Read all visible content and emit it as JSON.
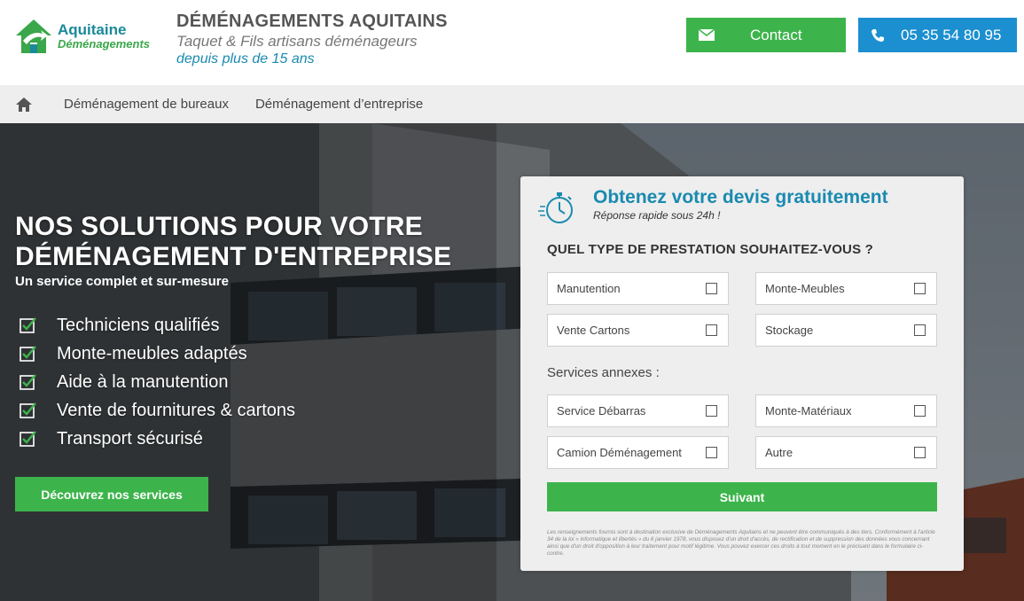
{
  "header": {
    "logo_line1": "Aquitaine",
    "logo_line2": "Déménagements",
    "tagline_title": "DÉMÉNAGEMENTS AQUITAINS",
    "tagline_sub": "Taquet & Fils artisans déménageurs",
    "tagline_since": "depuis plus de 15 ans",
    "contact_label": "Contact",
    "phone_label": "05 35 54 80 95"
  },
  "nav": {
    "items": [
      "Déménagement de bureaux",
      "Déménagement d’entreprise"
    ]
  },
  "hero": {
    "title_line1": "NOS SOLUTIONS POUR VOTRE",
    "title_line2": "DÉMÉNAGEMENT D'ENTREPRISE",
    "subtitle": "Un service complet et sur-mesure",
    "features": [
      "Techniciens qualifiés",
      "Monte-meubles adaptés",
      "Aide à la manutention",
      "Vente de fournitures & cartons",
      "Transport sécurisé"
    ],
    "cta_label": "Découvrez nos services"
  },
  "form": {
    "title": "Obtenez votre devis gratuitement",
    "subtitle": "Réponse rapide sous 24h !",
    "question": "QUEL TYPE DE PRESTATION SOUHAITEZ-VOUS ?",
    "options": [
      "Manutention",
      "Monte-Meubles",
      "Vente Cartons",
      "Stockage"
    ],
    "annex_label": "Services annexes :",
    "annex_options": [
      "Service Débarras",
      "Monte-Matériaux",
      "Camion Déménagement",
      "Autre"
    ],
    "next_label": "Suivant",
    "legal": "Les renseignements fournis sont à destination exclusive de Déménagements Aquitains et ne peuvent être communiqués à des tiers. Conformément à l'article 34 de la loi « informatique et libertés » du 6 janvier 1978, vous disposez d'un droit d'accès, de rectification et de suppression des données vous concernant ainsi que d'un droit d'opposition à leur traitement pour motif légitime. Vous pouvez exercer ces droits à tout moment en le précisant dans le formulaire ci-contre."
  },
  "colors": {
    "green": "#3cb44b",
    "blue": "#1b8fd0",
    "teal": "#1a8ab0",
    "nav_bg": "#eeeeee"
  },
  "icons": [
    "house-logo-icon",
    "envelope-icon",
    "phone-icon",
    "home-icon",
    "checkbox-checked-icon",
    "stopwatch-icon"
  ]
}
